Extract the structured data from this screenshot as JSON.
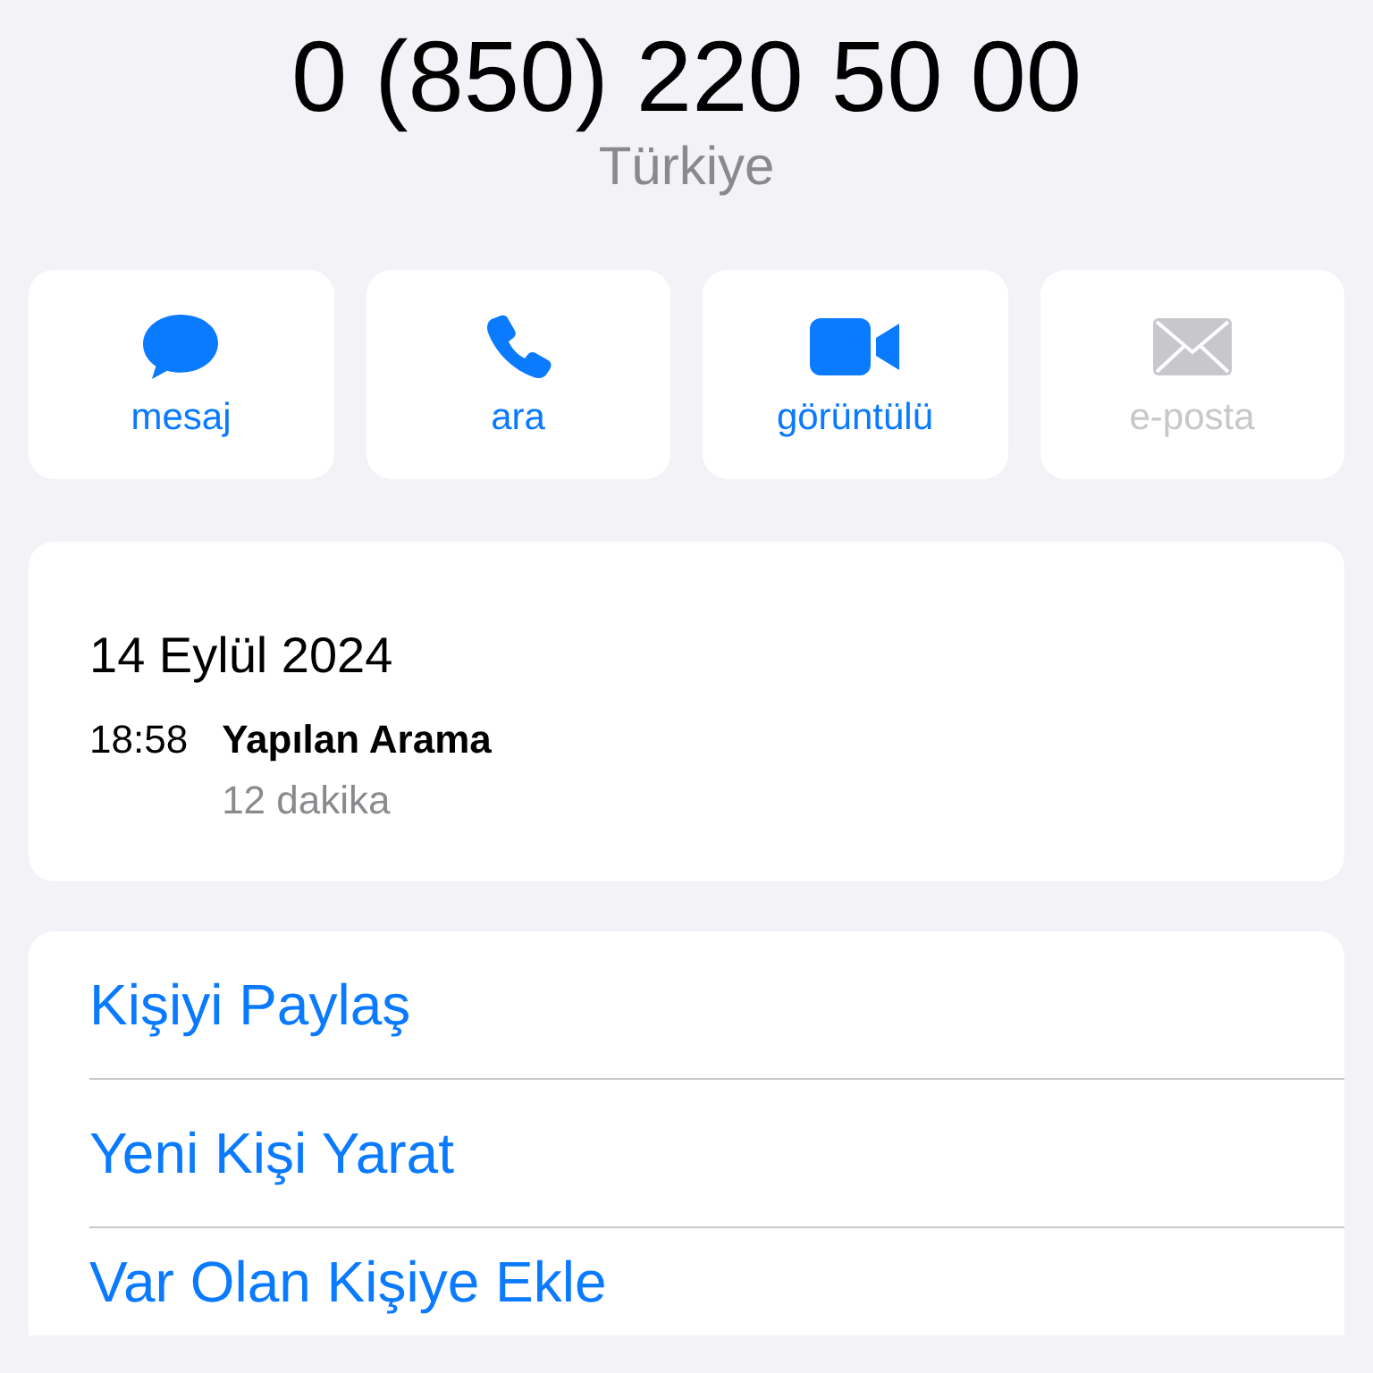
{
  "phone": "0 (850) 220 50 00",
  "region": "Türkiye",
  "actions": [
    {
      "kind": "message",
      "label": "mesaj",
      "disabled": false
    },
    {
      "kind": "call",
      "label": "ara",
      "disabled": false
    },
    {
      "kind": "video",
      "label": "görüntülü",
      "disabled": false
    },
    {
      "kind": "mail",
      "label": "e-posta",
      "disabled": true
    }
  ],
  "recent": {
    "date": "14 Eylül 2024",
    "calls": [
      {
        "time": "18:58",
        "type": "Yapılan Arama",
        "duration": "12 dakika"
      }
    ]
  },
  "options": [
    {
      "label": "Kişiyi Paylaş"
    },
    {
      "label": "Yeni Kişi Yarat"
    },
    {
      "label": "Var Olan Kişiye Ekle"
    }
  ]
}
